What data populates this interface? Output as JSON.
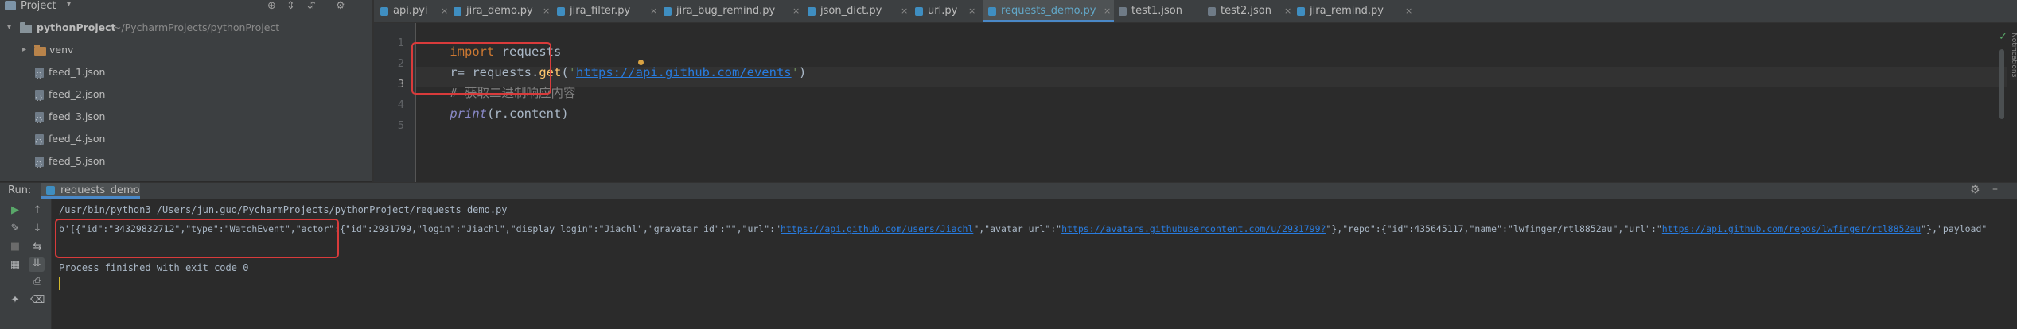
{
  "project_panel": {
    "title": "Project",
    "dropdown_glyph": "▾",
    "toolbar_icons": [
      "globe-icon",
      "collapse-icon",
      "expand-icon",
      "gear-icon",
      "minimize-icon"
    ],
    "root": {
      "name": "pythonProject",
      "path": "~/PycharmProjects/pythonProject"
    },
    "items": [
      {
        "name": "venv",
        "type": "folder"
      },
      {
        "name": "feed_1.json",
        "type": "json"
      },
      {
        "name": "feed_2.json",
        "type": "json"
      },
      {
        "name": "feed_3.json",
        "type": "json"
      },
      {
        "name": "feed_4.json",
        "type": "json"
      },
      {
        "name": "feed_5.json",
        "type": "json"
      }
    ]
  },
  "editor_tabs": [
    {
      "label": "api.pyi",
      "active": false
    },
    {
      "label": "jira_demo.py",
      "active": false
    },
    {
      "label": "jira_filter.py",
      "active": false
    },
    {
      "label": "jira_bug_remind.py",
      "active": false
    },
    {
      "label": "json_dict.py",
      "active": false
    },
    {
      "label": "url.py",
      "active": false
    },
    {
      "label": "requests_demo.py",
      "active": true
    },
    {
      "label": "test1.json",
      "active": false
    },
    {
      "label": "test2.json",
      "active": false
    },
    {
      "label": "jira_remind.py",
      "active": false
    }
  ],
  "tab_close_glyph": "×",
  "editor": {
    "line_numbers": [
      "1",
      "2",
      "3",
      "4",
      "5"
    ],
    "line1": {
      "kw": "import",
      "rest": " requests"
    },
    "line2": {
      "a": "r",
      "b": "= requests.",
      "fn": "get",
      "c": "(",
      "q1": "'",
      "url": "https://api.github.com/events",
      "q2": "'",
      "d": ")"
    },
    "line3": {
      "comment": "# 获取二进制响应内容"
    },
    "line4": {
      "builtin": "print",
      "rest": "(r.content)"
    },
    "inspection_ok": "✓",
    "right_gutter_label": "Notifications"
  },
  "run_panel": {
    "label": "Run:",
    "tab_label": "requests_demo",
    "command": "/usr/bin/python3 /Users/jun.guo/PycharmProjects/pythonProject/requests_demo.py",
    "output": {
      "p1": "b'[{\"id\":\"34329832712\",\"type\":\"WatchEvent\",\"actor\":{\"id\":2931799,\"login\":\"Jiachl\",\"display_login\":\"Jiachl\",\"gravatar_id\":\"\",\"url\":\"",
      "u1": "https://api.github.com/users/Jiachl",
      "p2": "\",\"avatar_url\":\"",
      "u2": "https://avatars.githubusercontent.com/u/2931799?",
      "p3": "\"},\"repo\":{\"id\":435645117,\"name\":\"lwfinger/rtl8852au\",\"url\":\"",
      "u3": "https://api.github.com/repos/lwfinger/rtl8852au",
      "p4": "\"},\"payload\""
    },
    "exit_message": "Process finished with exit code 0",
    "header_icons": [
      "gear-icon",
      "minimize-icon"
    ],
    "toolbar_buttons": [
      "rerun-icon",
      "up-arrow-icon",
      "wrench-icon",
      "down-arrow-icon",
      "stop-icon",
      "soft-wrap-icon",
      "restore-layout-icon",
      "scroll-to-end-icon",
      "print-icon",
      "pin-icon",
      "trash-icon"
    ]
  },
  "colors": {
    "annotation_box": "#d93b3b",
    "active_tab_underline": "#4a88c7",
    "run_green": "#59a869",
    "stop_red": "#c75450"
  }
}
